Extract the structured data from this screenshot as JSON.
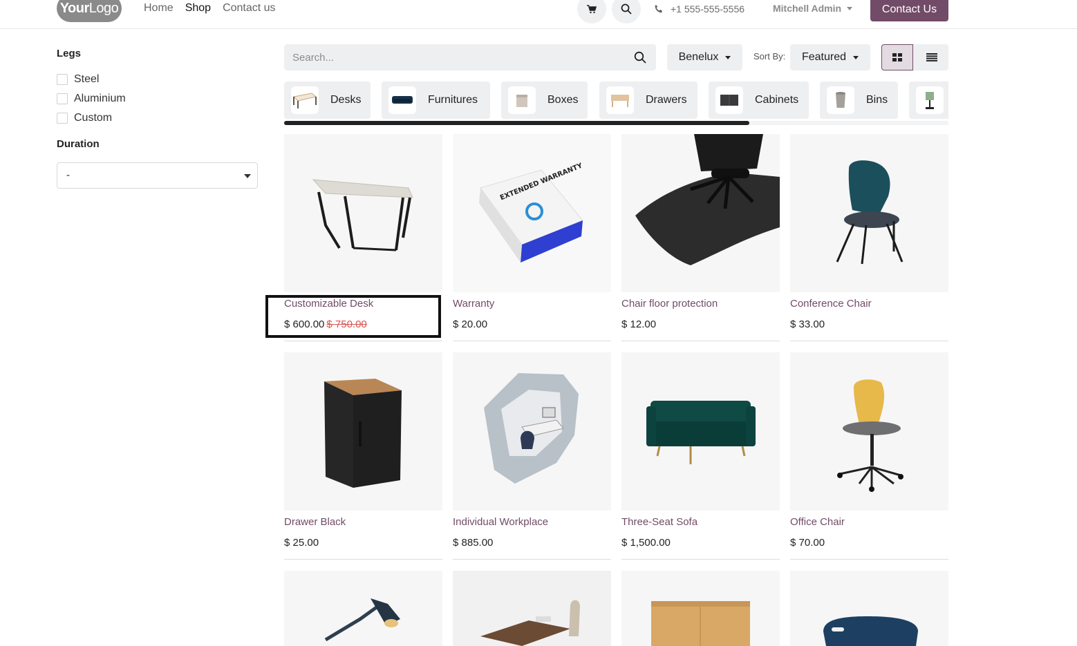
{
  "header": {
    "logo_main": "Your",
    "logo_rest": "Logo",
    "nav": [
      "Home",
      "Shop",
      "Contact us"
    ],
    "phone": "+1 555-555-5556",
    "user": "Mitchell Admin",
    "contact_button": "Contact Us"
  },
  "sidebar": {
    "legs_title": "Legs",
    "legs_options": [
      "Steel",
      "Aluminium",
      "Custom"
    ],
    "duration_title": "Duration",
    "duration_value": "-"
  },
  "toolbar": {
    "search_placeholder": "Search...",
    "pricelist": "Benelux",
    "sort_label": "Sort By:",
    "sort_value": "Featured"
  },
  "categories": [
    "Desks",
    "Furnitures",
    "Boxes",
    "Drawers",
    "Cabinets",
    "Bins"
  ],
  "products": [
    {
      "name": "Customizable Desk",
      "price": "$ 600.00",
      "old_price": "$ 750.00"
    },
    {
      "name": "Warranty",
      "price": "$ 20.00"
    },
    {
      "name": "Chair floor protection",
      "price": "$ 12.00"
    },
    {
      "name": "Conference Chair",
      "price": "$ 33.00"
    },
    {
      "name": "Drawer Black",
      "price": "$ 25.00"
    },
    {
      "name": "Individual Workplace",
      "price": "$ 885.00"
    },
    {
      "name": "Three-Seat Sofa",
      "price": "$ 1,500.00"
    },
    {
      "name": "Office Chair",
      "price": "$ 70.00"
    }
  ],
  "warranty_box_text": "EXTENDED WARRANTY",
  "colors": {
    "brand": "#714b67",
    "strike": "#d9534f"
  }
}
